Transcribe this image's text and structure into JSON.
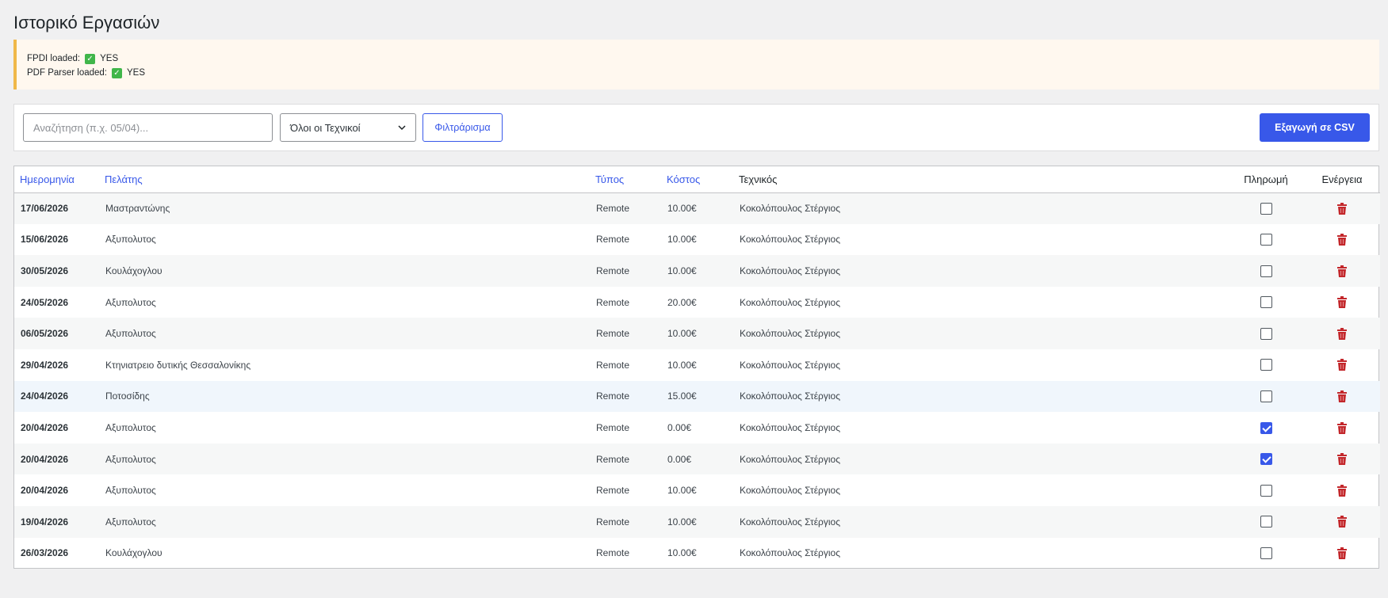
{
  "page": {
    "title": "Ιστορικό Εργασιών"
  },
  "notice": {
    "lines": [
      {
        "label": "FPDI loaded:",
        "value": "YES"
      },
      {
        "label": "PDF Parser loaded:",
        "value": "YES"
      }
    ]
  },
  "filters": {
    "search_placeholder": "Αναζήτηση (π.χ. 05/04)...",
    "technician_select": "Όλοι οι Τεχνικοί",
    "filter_button": "Φιλτράρισμα",
    "export_button": "Εξαγωγή σε CSV"
  },
  "table": {
    "headers": {
      "date": "Ημερομηνία",
      "client": "Πελάτης",
      "type": "Τύπος",
      "cost": "Κόστος",
      "technician": "Τεχνικός",
      "payment": "Πληρωμή",
      "action": "Ενέργεια"
    },
    "rows": [
      {
        "date": "17/06/2026",
        "client": "Μαστραντώνης",
        "type": "Remote",
        "cost": "10.00€",
        "technician": "Κοκολόπουλος Στέργιος",
        "paid": false
      },
      {
        "date": "15/06/2026",
        "client": "Αξυπολυτος",
        "type": "Remote",
        "cost": "10.00€",
        "technician": "Κοκολόπουλος Στέργιος",
        "paid": false
      },
      {
        "date": "30/05/2026",
        "client": "Κουλάχογλου",
        "type": "Remote",
        "cost": "10.00€",
        "technician": "Κοκολόπουλος Στέργιος",
        "paid": false
      },
      {
        "date": "24/05/2026",
        "client": "Αξυπολυτος",
        "type": "Remote",
        "cost": "20.00€",
        "technician": "Κοκολόπουλος Στέργιος",
        "paid": false
      },
      {
        "date": "06/05/2026",
        "client": "Αξυπολυτος",
        "type": "Remote",
        "cost": "10.00€",
        "technician": "Κοκολόπουλος Στέργιος",
        "paid": false
      },
      {
        "date": "29/04/2026",
        "client": "Κτηνιατρειο δυτικής Θεσσαλονίκης",
        "type": "Remote",
        "cost": "10.00€",
        "technician": "Κοκολόπουλος Στέργιος",
        "paid": false
      },
      {
        "date": "24/04/2026",
        "client": "Ποτοσίδης",
        "type": "Remote",
        "cost": "15.00€",
        "technician": "Κοκολόπουλος Στέργιος",
        "paid": false
      },
      {
        "date": "20/04/2026",
        "client": "Αξυπολυτος",
        "type": "Remote",
        "cost": "0.00€",
        "technician": "Κοκολόπουλος Στέργιος",
        "paid": true
      },
      {
        "date": "20/04/2026",
        "client": "Αξυπολυτος",
        "type": "Remote",
        "cost": "0.00€",
        "technician": "Κοκολόπουλος Στέργιος",
        "paid": true
      },
      {
        "date": "20/04/2026",
        "client": "Αξυπολυτος",
        "type": "Remote",
        "cost": "10.00€",
        "technician": "Κοκολόπουλος Στέργιος",
        "paid": false
      },
      {
        "date": "19/04/2026",
        "client": "Αξυπολυτος",
        "type": "Remote",
        "cost": "10.00€",
        "technician": "Κοκολόπουλος Στέργιος",
        "paid": false
      },
      {
        "date": "26/03/2026",
        "client": "Κουλάχογλου",
        "type": "Remote",
        "cost": "10.00€",
        "technician": "Κοκολόπουλος Στέργιος",
        "paid": false
      }
    ]
  },
  "colors": {
    "accent": "#3858e9",
    "notice_border": "#f0b849",
    "delete": "#c3272b"
  }
}
